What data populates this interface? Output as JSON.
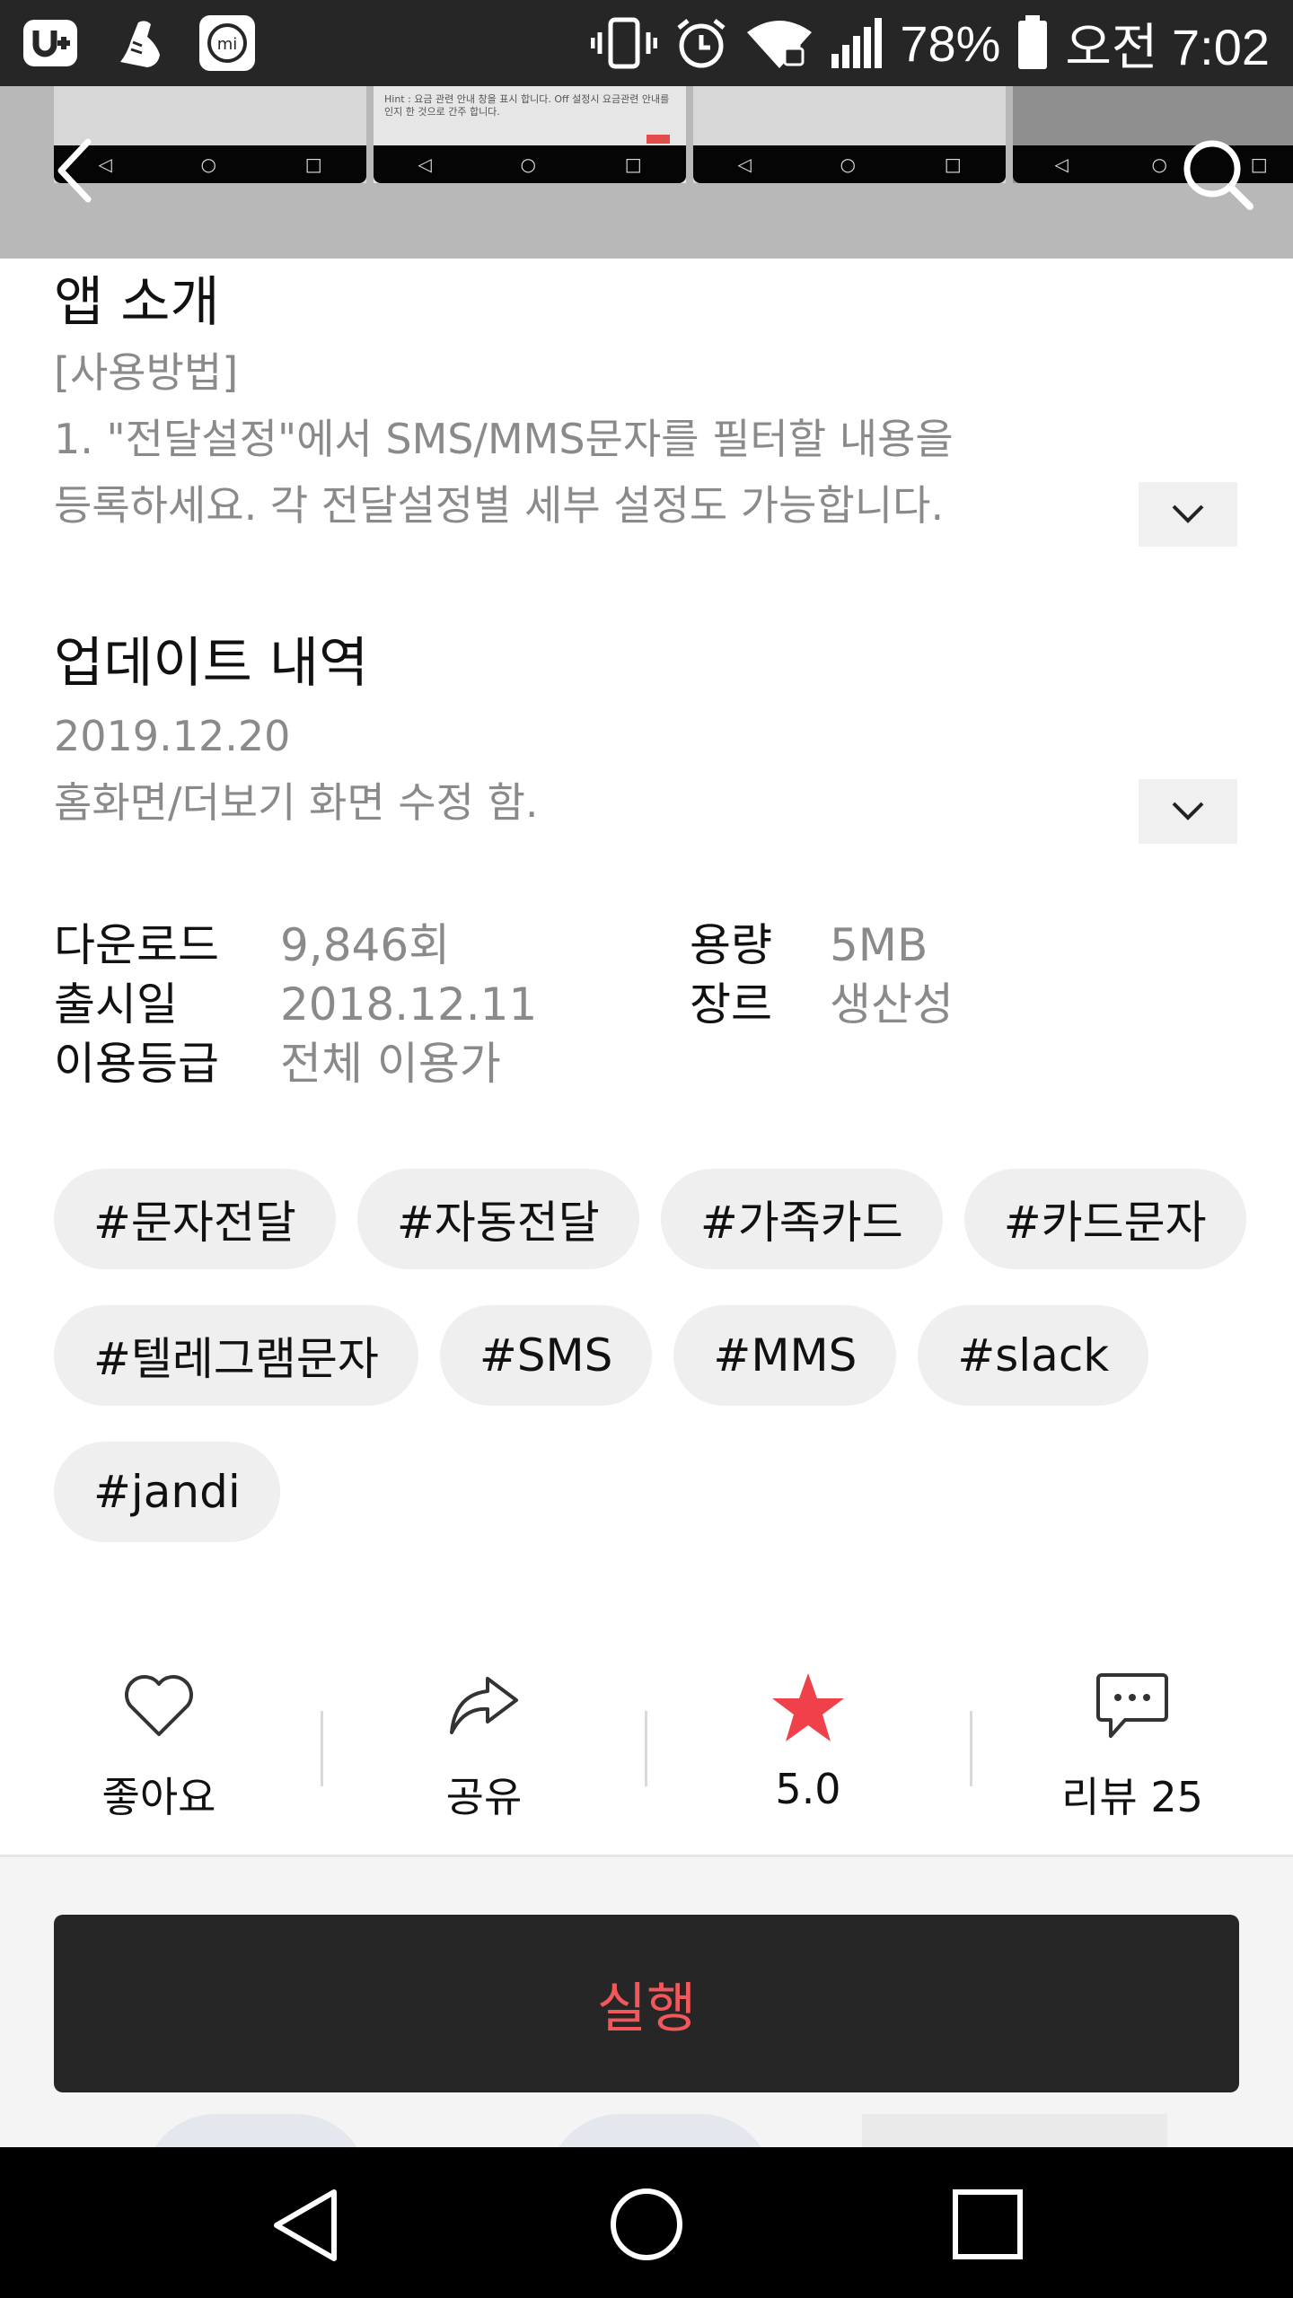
{
  "status_bar": {
    "battery": "78%",
    "time": "오전 7:02"
  },
  "top": {
    "screenshot_hint": "Hint : 요금 관련 안내 창을 표시 합니다. Off 설정시 요금관련 안내를 인지 한 것으로 간주 합니다."
  },
  "intro": {
    "title": "앱 소개",
    "lines": [
      "[사용방법]",
      "1. \"전달설정\"에서 SMS/MMS문자를 필터할 내용을",
      "등록하세요. 각 전달설정별 세부 설정도 가능합니다."
    ]
  },
  "update": {
    "title": "업데이트 내역",
    "date": "2019.12.20",
    "text": "홈화면/더보기 화면 수정 함."
  },
  "info": {
    "downloads_label": "다운로드",
    "downloads_value": "9,846회",
    "release_label": "출시일",
    "release_value": "2018.12.11",
    "rating_label": "이용등급",
    "rating_value": "전체 이용가",
    "size_label": "용량",
    "size_value": "5MB",
    "genre_label": "장르",
    "genre_value": "생산성"
  },
  "tags": [
    "#문자전달",
    "#자동전달",
    "#가족카드",
    "#카드문자",
    "#텔레그램문자",
    "#SMS",
    "#MMS",
    "#slack",
    "#jandi"
  ],
  "actions": {
    "like": "좋아요",
    "share": "공유",
    "score": "5.0",
    "reviews": "리뷰 25"
  },
  "run": {
    "label": "실행"
  },
  "colors": {
    "accent": "#f2575a",
    "star": "#f0404a",
    "dark": "#262626",
    "muted_text": "#8a8a8a"
  },
  "icons": [
    "back-arrow-icon",
    "search-icon",
    "chevron-down-icon",
    "heart-icon",
    "share-icon",
    "star-icon",
    "chat-bubble-icon",
    "nav-back-icon",
    "nav-home-icon",
    "nav-recents-icon"
  ]
}
